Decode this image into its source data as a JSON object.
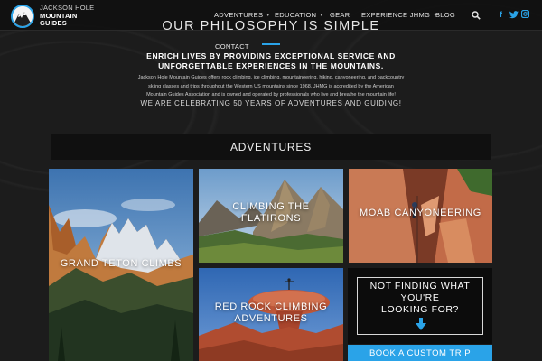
{
  "brand": {
    "line1": "JACKSON HOLE",
    "line2": "MOUNTAIN",
    "line3": "GUIDES",
    "accent": "#2aa3e8"
  },
  "nav": {
    "items": [
      {
        "label": "ADVENTURES",
        "dropdown": true
      },
      {
        "label": "EDUCATION",
        "dropdown": true
      },
      {
        "label": "GEAR",
        "dropdown": false
      },
      {
        "label": "EXPERIENCE JHMG",
        "dropdown": true
      },
      {
        "label": "BLOG",
        "dropdown": false
      },
      {
        "label": "CONTACT",
        "dropdown": false
      }
    ],
    "search_icon": "search-icon",
    "social": [
      {
        "icon": "facebook-icon",
        "glyph": "f"
      },
      {
        "icon": "twitter-icon",
        "glyph": "t"
      },
      {
        "icon": "instagram-icon",
        "glyph": "◘"
      }
    ]
  },
  "philosophy": {
    "title": "OUR PHILOSOPHY IS SIMPLE",
    "headline_1": "ENRICH LIVES BY PROVIDING EXCEPTIONAL SERVICE AND",
    "headline_2": "UNFORGETTABLE EXPERIENCES IN THE MOUNTAINS.",
    "para_1": "Jackson Hole Mountain Guides offers rock climbing, ice climbing, mountaineering, hiking, canyoneering, and backcountry",
    "para_2": "skiing classes and trips throughout the Western US mountains since 1968. JHMG is accredited by the American",
    "para_3": "Mountain Guides Association and is owned and operated by professionals who live and breathe the mountain life!",
    "celebrate": "WE ARE CELEBRATING 50 YEARS OF ADVENTURES AND GUIDING!"
  },
  "adventures": {
    "heading": "ADVENTURES",
    "tiles": [
      {
        "label": "GRAND TETON CLIMBS"
      },
      {
        "label_1": "CLIMBING THE",
        "label_2": "FLATIRONS"
      },
      {
        "label": "MOAB CANYONEERING"
      },
      {
        "label_1": "RED ROCK CLIMBING",
        "label_2": "ADVENTURES"
      }
    ],
    "finder": {
      "line_1": "NOT FINDING WHAT",
      "line_2": "YOU'RE",
      "line_3": "LOOKING FOR?"
    },
    "custom_trip": "BOOK A CUSTOM TRIP"
  }
}
